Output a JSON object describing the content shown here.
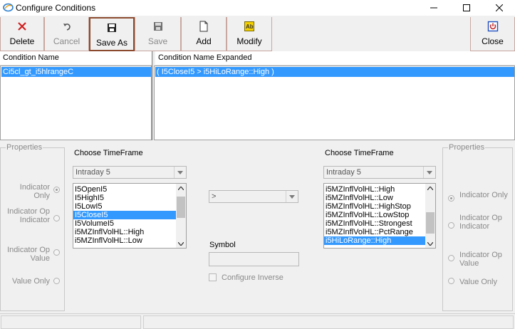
{
  "window": {
    "title": "Configure Conditions"
  },
  "toolbar": {
    "delete_label": "Delete",
    "cancel_label": "Cancel",
    "save_as_label": "Save As",
    "save_label": "Save",
    "add_label": "Add",
    "modify_label": "Modify",
    "close_label": "Close"
  },
  "conditions": {
    "name_header": "Condition Name",
    "expanded_header": "Condition Name Expanded",
    "selected_name": "Ci5cl_gt_i5hlrangeC",
    "selected_expanded": "( I5CloseI5 > i5HiLoRange::High )"
  },
  "left_properties": {
    "title": "Properties",
    "indicator_only": "Indicator Only",
    "indicator_op_indicator": "Indicator Op Indicator",
    "indicator_op_value": "Indicator Op Value",
    "value_only": "Value Only"
  },
  "right_properties": {
    "title": "Properties",
    "indicator_only": "Indicator Only",
    "indicator_op_indicator": "Indicator Op Indicator",
    "indicator_op_value": "Indicator Op Value",
    "value_only": "Value Only"
  },
  "left_timeframe": {
    "label": "Choose TimeFrame",
    "value": "Intraday 5",
    "items": [
      "I5OpenI5",
      "I5HighI5",
      "I5LowI5",
      "I5CloseI5",
      "I5VolumeI5",
      "i5MZInflVolHL::High",
      "i5MZInflVolHL::Low"
    ],
    "selected_index": 3
  },
  "right_timeframe": {
    "label": "Choose TimeFrame",
    "value": "Intraday 5",
    "items": [
      "i5MZInflVolHL::High",
      "i5MZInflVolHL::Low",
      "i5MZInflVolHL::HighStop",
      "i5MZInflVolHL::LowStop",
      "i5MZInflVolHL::Strongest",
      "i5MZInflVolHL::PctRange",
      "i5HiLoRange::High"
    ],
    "selected_index": 6
  },
  "operator": {
    "value": ">"
  },
  "symbol": {
    "label": "Symbol",
    "value": ""
  },
  "configure_inverse": {
    "label": "Configure Inverse",
    "checked": false
  }
}
